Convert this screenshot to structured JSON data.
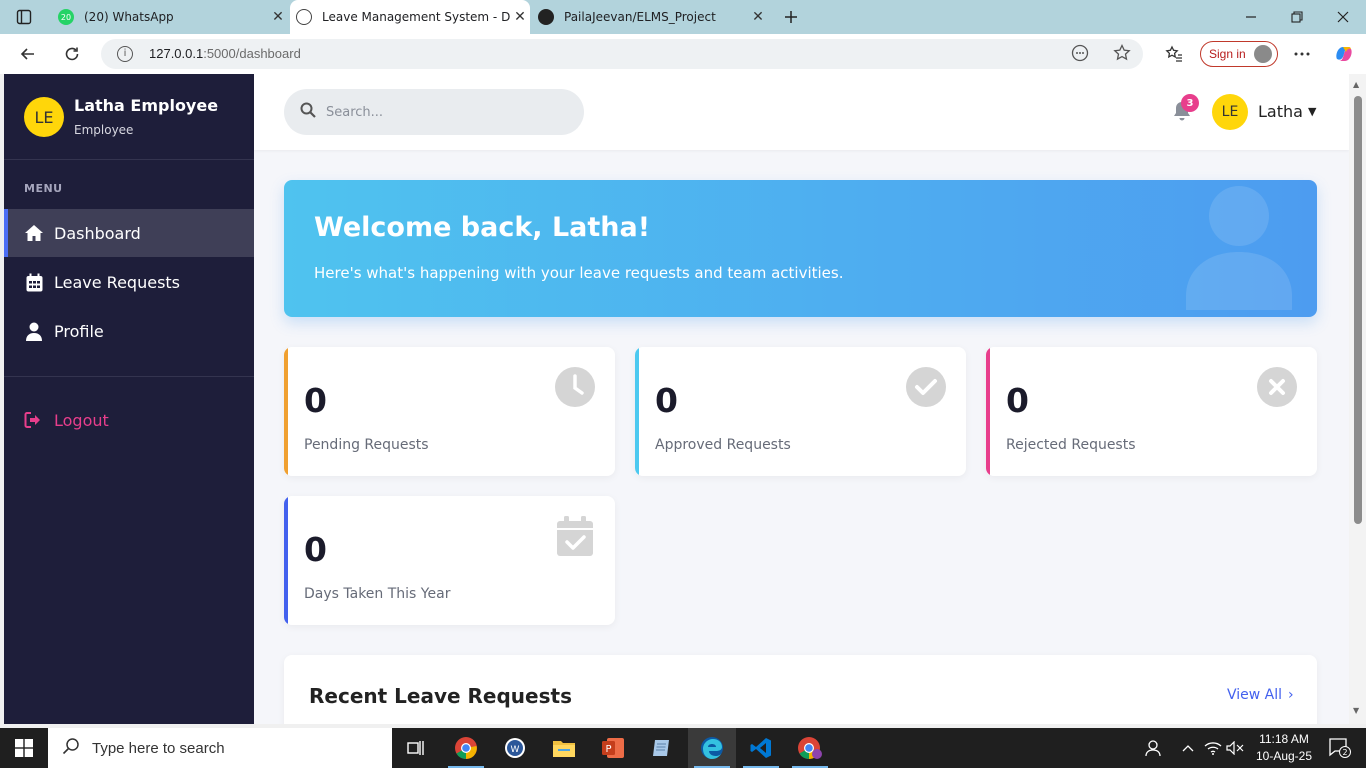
{
  "browser": {
    "tabs": [
      {
        "label": "(20) WhatsApp",
        "badge": "20"
      },
      {
        "label": "Leave Management System - Dashboard"
      },
      {
        "label": "PailaJeevan/ELMS_Project"
      }
    ],
    "url_host": "127.0.0.1",
    "url_path": ":5000/dashboard",
    "signin_label": "Sign in"
  },
  "sidebar": {
    "avatar_initials": "LE",
    "user_name": "Latha Employee",
    "user_role": "Employee",
    "menu_title": "MENU",
    "items": [
      {
        "label": "Dashboard",
        "icon": "home-icon",
        "active": true
      },
      {
        "label": "Leave Requests",
        "icon": "calendar-icon"
      },
      {
        "label": "Profile",
        "icon": "user-icon"
      }
    ],
    "logout_label": "Logout"
  },
  "topbar": {
    "search_placeholder": "Search...",
    "notification_count": "3",
    "avatar_initials": "LE",
    "user_name": "Latha"
  },
  "welcome": {
    "title": "Welcome back, Latha!",
    "subtitle": "Here's what's happening with your leave requests and team activities."
  },
  "stats": [
    {
      "value": "0",
      "label": "Pending Requests",
      "icon": "clock-icon",
      "color": "#f0a030"
    },
    {
      "value": "0",
      "label": "Approved Requests",
      "icon": "check-circle-icon",
      "color": "#4cc9f0"
    },
    {
      "value": "0",
      "label": "Rejected Requests",
      "icon": "x-circle-icon",
      "color": "#e83e8c"
    },
    {
      "value": "0",
      "label": "Days Taken This Year",
      "icon": "calendar-check-icon",
      "color": "#4361ee"
    }
  ],
  "recent": {
    "title": "Recent Leave Requests",
    "view_all_label": "View All"
  },
  "taskbar": {
    "search_placeholder": "Type here to search",
    "time": "11:18 AM",
    "date": "10-Aug-25",
    "notifications_count": "2"
  },
  "colors": {
    "sidebar_bg": "#1e1e3a",
    "accent": "#4361ee",
    "logout": "#e83e8c",
    "avatar": "#ffd60a"
  }
}
